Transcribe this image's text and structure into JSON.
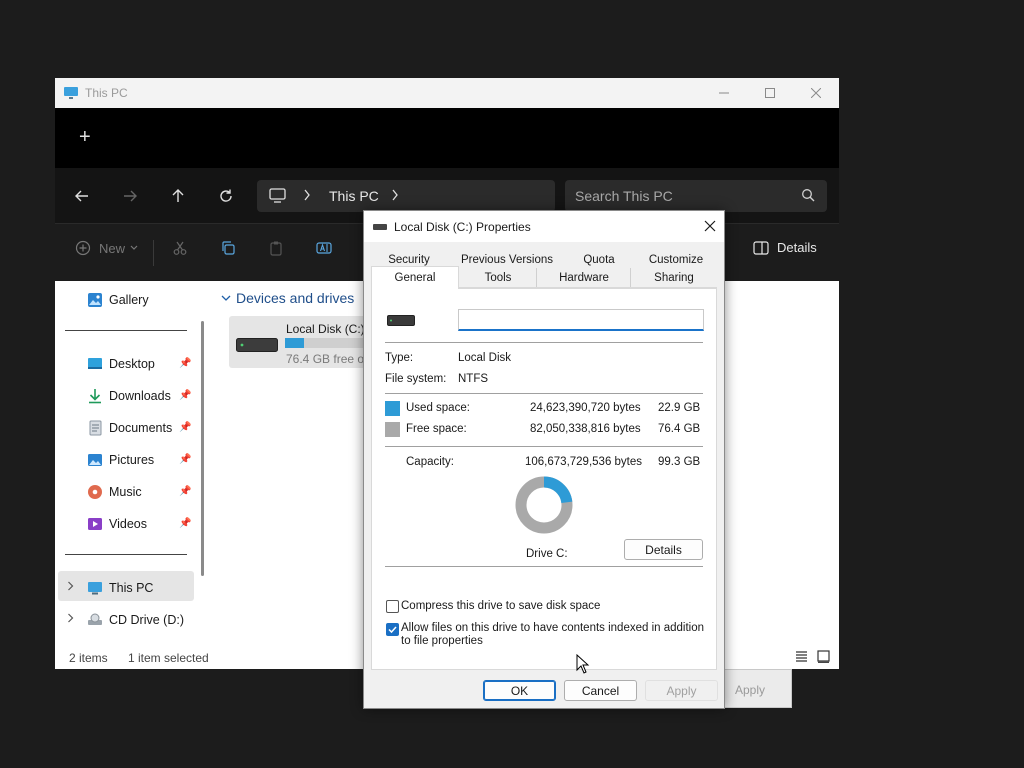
{
  "explorer": {
    "title": "This PC",
    "new_tab_glyph": "+",
    "address": {
      "crumb": "This PC"
    },
    "search": {
      "placeholder": "Search This PC"
    },
    "toolbar": {
      "new_label": "New",
      "details_label": "Details"
    },
    "sidebar": {
      "top_item": "Gallery",
      "quick_access": [
        {
          "label": "Desktop",
          "icon": "desktop-icon"
        },
        {
          "label": "Downloads",
          "icon": "download-icon"
        },
        {
          "label": "Documents",
          "icon": "documents-icon"
        },
        {
          "label": "Pictures",
          "icon": "pictures-icon"
        },
        {
          "label": "Music",
          "icon": "music-icon"
        },
        {
          "label": "Videos",
          "icon": "videos-icon"
        }
      ],
      "tree": [
        {
          "label": "This PC",
          "selected": true
        },
        {
          "label": "CD Drive (D:)"
        }
      ]
    },
    "content": {
      "group_label": "Devices and drives",
      "drive": {
        "name": "Local Disk (C:)",
        "free_text": "76.4 GB free of",
        "used_fraction": 0.23
      }
    },
    "status": {
      "items": "2 items",
      "selected": "1 item selected"
    }
  },
  "dialog": {
    "title": "Local Disk (C:) Properties",
    "tabs_row1": [
      "Security",
      "Previous Versions",
      "Quota",
      "Customize"
    ],
    "tabs_row2": [
      "General",
      "Tools",
      "Hardware",
      "Sharing"
    ],
    "active_tab": "General",
    "volume_label_value": "",
    "type_label": "Type:",
    "type_value": "Local Disk",
    "fs_label": "File system:",
    "fs_value": "NTFS",
    "used": {
      "label": "Used space:",
      "bytes": "24,623,390,720 bytes",
      "gb": "22.9 GB",
      "color": "#2e9bd6"
    },
    "free": {
      "label": "Free space:",
      "bytes": "82,050,338,816 bytes",
      "gb": "76.4 GB",
      "color": "#a9a9a9"
    },
    "capacity": {
      "label": "Capacity:",
      "bytes": "106,673,729,536 bytes",
      "gb": "99.3 GB"
    },
    "drive_caption": "Drive C:",
    "details_button": "Details",
    "compress_label": "Compress this drive to save disk space",
    "compress_checked": false,
    "index_label": "Allow files on this drive to have contents indexed in addition to file properties",
    "index_checked": true,
    "ok": "OK",
    "cancel": "Cancel",
    "apply": "Apply",
    "behind_apply": "Apply"
  }
}
